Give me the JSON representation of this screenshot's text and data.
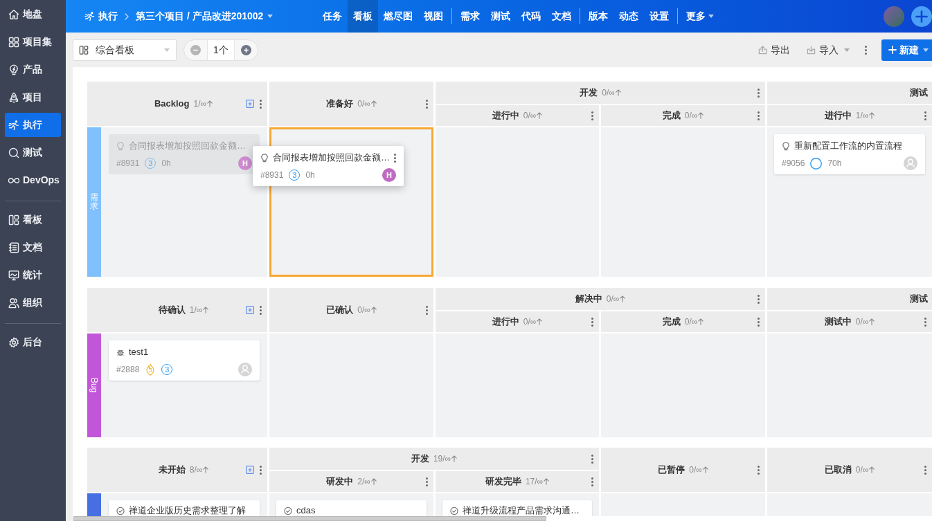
{
  "sidebar": {
    "sections": [
      {
        "items": [
          {
            "label": "地盘",
            "selected": false
          },
          {
            "label": "项目集",
            "selected": false
          },
          {
            "label": "产品",
            "selected": false
          },
          {
            "label": "项目",
            "selected": false
          },
          {
            "label": "执行",
            "selected": true
          },
          {
            "label": "测试",
            "selected": false
          },
          {
            "label": "DevOps",
            "selected": false
          }
        ]
      },
      {
        "items": [
          {
            "label": "看板",
            "selected": false
          },
          {
            "label": "文档",
            "selected": false
          },
          {
            "label": "统计",
            "selected": false
          },
          {
            "label": "组织",
            "selected": false
          }
        ]
      },
      {
        "items": [
          {
            "label": "后台",
            "selected": false
          }
        ]
      }
    ]
  },
  "header": {
    "breadcrumb": [
      {
        "label": "执行",
        "dropdown": false
      },
      {
        "label": "第三个项目 / 产品改进201002",
        "dropdown": true
      }
    ],
    "nav": {
      "groups": [
        {
          "items": [
            {
              "label": "任务",
              "selected": false,
              "dropdown": false
            },
            {
              "label": "看板",
              "selected": true,
              "dropdown": false
            },
            {
              "label": "燃尽图",
              "selected": false,
              "dropdown": false
            },
            {
              "label": "视图",
              "selected": false,
              "dropdown": false
            }
          ]
        },
        {
          "items": [
            {
              "label": "需求",
              "selected": false,
              "dropdown": false
            },
            {
              "label": "测试",
              "selected": false,
              "dropdown": false
            },
            {
              "label": "代码",
              "selected": false,
              "dropdown": false
            },
            {
              "label": "文档",
              "selected": false,
              "dropdown": false
            }
          ]
        },
        {
          "items": [
            {
              "label": "版本",
              "selected": false,
              "dropdown": false
            },
            {
              "label": "动态",
              "selected": false,
              "dropdown": false
            },
            {
              "label": "设置",
              "selected": false,
              "dropdown": false
            }
          ]
        },
        {
          "items": [
            {
              "label": "更多",
              "selected": false,
              "dropdown": true
            }
          ]
        }
      ]
    }
  },
  "toolbar": {
    "board_select": {
      "value": "综合看板"
    },
    "stepper": {
      "value": "1个"
    },
    "actions": [
      {
        "kind": "export",
        "label": "导出",
        "dropdown": false
      },
      {
        "kind": "import",
        "label": "导入",
        "dropdown": true
      }
    ],
    "create_button": {
      "label": "新建",
      "dropdown": true
    }
  },
  "lanes": [
    {
      "kind": "stacked",
      "label": "需求",
      "color": "#80c0fd",
      "columns": [
        {
          "name": "Backlog",
          "count": "1/∞",
          "addable": true,
          "menu": true,
          "highlighted": false,
          "cards": [
            {
              "kind": "story",
              "title": "合同报表增加按照回款金额…",
              "faded": true,
              "menu": false,
              "footer": [
                {
                  "kind": "id",
                  "text": "#8931"
                },
                {
                  "kind": "priority",
                  "text": "3"
                },
                {
                  "kind": "estimate",
                  "text": "0h"
                }
              ],
              "assignee": {
                "kind": "initial",
                "text": "H",
                "color": "#cd8ccf"
              }
            }
          ]
        },
        {
          "name": "准备好",
          "count": "0/∞",
          "addable": false,
          "menu": true,
          "highlighted": true
        },
        {
          "name": "开发",
          "count": "0/∞",
          "addable": false,
          "menu": true,
          "children": [
            {
              "name": "进行中",
              "count": "0/∞",
              "addable": false,
              "menu": true,
              "highlighted": false
            },
            {
              "name": "完成",
              "count": "0/∞",
              "addable": false,
              "menu": true,
              "highlighted": false
            }
          ]
        },
        {
          "name": "测试",
          "addable": false,
          "menu": false,
          "children": [
            {
              "name": "进行中",
              "count": "1/∞",
              "addable": false,
              "menu": true,
              "highlighted": false,
              "cards": [
                {
                  "kind": "story",
                  "title": "重新配置工作流的内置流程",
                  "faded": false,
                  "menu": false,
                  "footer": [
                    {
                      "kind": "id",
                      "text": "#9056"
                    },
                    {
                      "kind": "priority"
                    },
                    {
                      "kind": "estimate",
                      "text": "70h"
                    }
                  ],
                  "assignee": {
                    "kind": "default"
                  }
                }
              ]
            }
          ]
        }
      ]
    },
    {
      "kind": "rotated",
      "label": "Bug",
      "color": "#c157d8",
      "columns": [
        {
          "name": "待确认",
          "count": "1/∞",
          "addable": true,
          "menu": true,
          "highlighted": false,
          "cards": [
            {
              "kind": "bug",
              "title": "test1",
              "faded": false,
              "menu": false,
              "footer": [
                {
                  "kind": "id",
                  "text": "#2888"
                },
                {
                  "kind": "severity",
                  "text": "3"
                },
                {
                  "kind": "priority",
                  "text": "3"
                }
              ],
              "assignee": {
                "kind": "default"
              }
            }
          ]
        },
        {
          "name": "已确认",
          "count": "0/∞",
          "addable": false,
          "menu": true,
          "highlighted": false
        },
        {
          "name": "解决中",
          "count": "0/∞",
          "addable": false,
          "menu": true,
          "children": [
            {
              "name": "进行中",
              "count": "0/∞",
              "addable": false,
              "menu": true,
              "highlighted": false
            },
            {
              "name": "完成",
              "count": "0/∞",
              "addable": false,
              "menu": true,
              "highlighted": false
            }
          ]
        },
        {
          "name": "测试",
          "addable": false,
          "menu": false,
          "children": [
            {
              "name": "测试中",
              "count": "0/∞",
              "addable": false,
              "menu": true,
              "highlighted": false
            }
          ]
        }
      ]
    },
    {
      "kind": "plain",
      "color": "#476fe2",
      "columns": [
        {
          "name": "未开始",
          "count": "8/∞",
          "addable": true,
          "menu": true,
          "highlighted": false,
          "cards": [
            {
              "kind": "task",
              "title": "禅道企业版历史需求整理了解",
              "faded": false,
              "menu": false
            }
          ]
        },
        {
          "name": "开发",
          "count": "19/∞",
          "addable": false,
          "menu": true,
          "children": [
            {
              "name": "研发中",
              "count": "2/∞",
              "addable": false,
              "menu": true,
              "highlighted": false,
              "cards": [
                {
                  "kind": "task",
                  "title": "cdas",
                  "faded": false,
                  "menu": false
                }
              ]
            },
            {
              "name": "研发完毕",
              "count": "17/∞",
              "addable": false,
              "menu": true,
              "highlighted": false,
              "cards": [
                {
                  "kind": "task",
                  "title": "禅道升级流程产品需求沟通…",
                  "faded": false,
                  "menu": false
                }
              ]
            }
          ]
        },
        {
          "name": "已暂停",
          "count": "0/∞",
          "addable": false,
          "menu": true,
          "highlighted": false
        },
        {
          "name": "已取消",
          "count": "0/∞",
          "addable": false,
          "menu": true,
          "highlighted": false
        }
      ]
    }
  ],
  "drag_preview": {
    "kind": "story",
    "title": "合同报表增加按照回款金额…",
    "faded": false,
    "menu": true,
    "footer": [
      {
        "kind": "id",
        "text": "#8931"
      },
      {
        "kind": "priority",
        "text": "3"
      },
      {
        "kind": "estimate",
        "text": "0h"
      }
    ],
    "assignee": {
      "kind": "initial",
      "text": "H",
      "color": "#c06bc2"
    }
  }
}
